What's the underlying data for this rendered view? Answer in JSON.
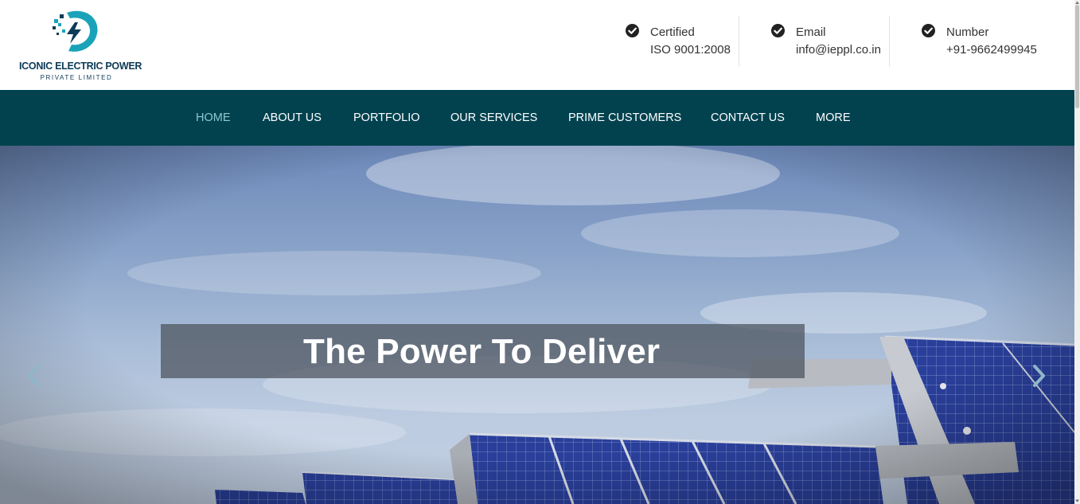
{
  "brand": {
    "name": "ICONIC ELECTRIC POWER",
    "subtitle": "PRIVATE LIMITED",
    "logo_icon": "lightning-bolt-logo-icon"
  },
  "header_info": [
    {
      "icon": "check-circle-icon",
      "label": "Certified",
      "value": "ISO 9001:2008"
    },
    {
      "icon": "check-circle-icon",
      "label": "Email",
      "value": "info@ieppl.co.in"
    },
    {
      "icon": "check-circle-icon",
      "label": "Number",
      "value": "+91-9662499945"
    }
  ],
  "nav": {
    "items": [
      {
        "label": "HOME",
        "active": true
      },
      {
        "label": "ABOUT US",
        "active": false
      },
      {
        "label": "PORTFOLIO",
        "active": false
      },
      {
        "label": "OUR SERVICES",
        "active": false
      },
      {
        "label": "PRIME CUSTOMERS",
        "active": false
      },
      {
        "label": "CONTACT US",
        "active": false
      },
      {
        "label": "MORE",
        "active": false
      }
    ]
  },
  "hero": {
    "caption": "The Power To Deliver",
    "prev_icon": "chevron-left-icon",
    "next_icon": "chevron-right-icon"
  },
  "colors": {
    "navbar_bg": "#02424f",
    "nav_active": "#8ec9d0",
    "logo_teal": "#1aa3b8",
    "logo_navy": "#0d3b57",
    "panel_blue": "#2a3f9a"
  }
}
